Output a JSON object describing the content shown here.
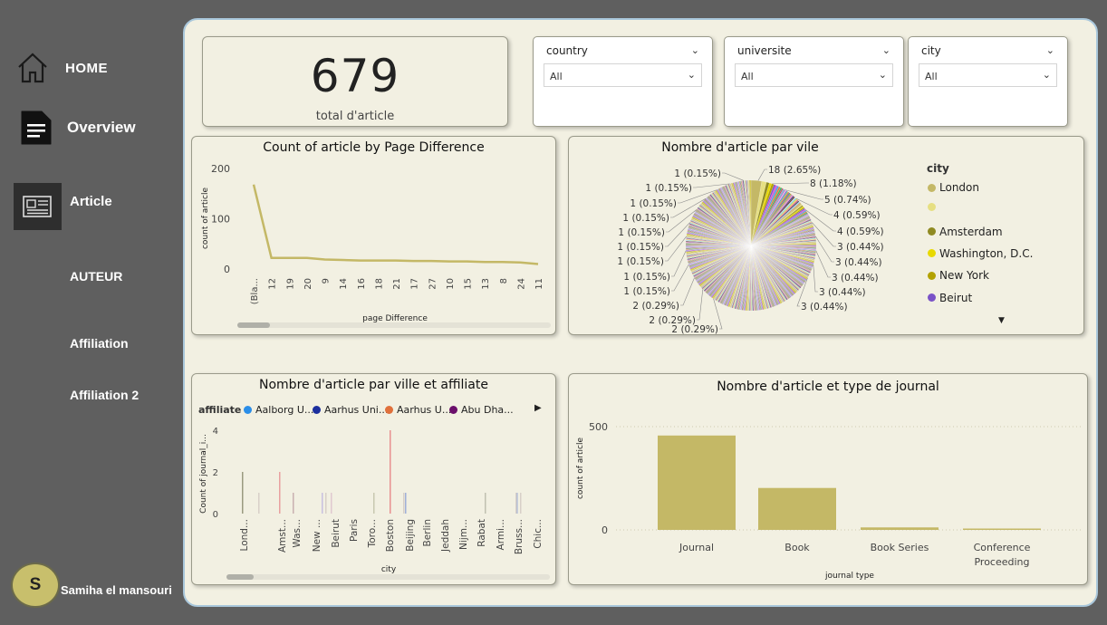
{
  "sidebar": {
    "home_label": "HOME",
    "overview_label": "Overview",
    "article_label": "Article",
    "auteur_label": "AUTEUR",
    "affiliation_label": "Affiliation",
    "affiliation2_label": "Affiliation 2",
    "user_initial": "S",
    "user_name": "Samiha el mansouri"
  },
  "kpi": {
    "value": "679",
    "label": "total d'article"
  },
  "slicers": [
    {
      "title": "country",
      "value": "All"
    },
    {
      "title": "universite",
      "value": "All"
    },
    {
      "title": "city",
      "value": "All"
    }
  ],
  "colors": {
    "accent": "#c4b866",
    "canvas": "#f2f0e2",
    "background": "#5f5f5f"
  },
  "chart_data": [
    {
      "type": "line",
      "title": "Count of article by Page Difference",
      "xlabel": "page Difference",
      "ylabel": "count of article",
      "yticks": [
        0,
        100,
        200
      ],
      "ylim": [
        0,
        200
      ],
      "categories": [
        "(Bla...",
        "12",
        "19",
        "20",
        "9",
        "14",
        "16",
        "18",
        "21",
        "17",
        "27",
        "10",
        "15",
        "13",
        "8",
        "24",
        "11"
      ],
      "values": [
        168,
        22,
        22,
        22,
        19,
        18,
        17,
        17,
        17,
        16,
        16,
        15,
        15,
        14,
        14,
        13,
        10
      ]
    },
    {
      "type": "pie",
      "title": "Nombre d'article par vile",
      "legend_title": "city",
      "legend": [
        {
          "name": "London",
          "color": "#c4b866"
        },
        {
          "name": "",
          "color": "#e6df82"
        },
        {
          "name": "Amsterdam",
          "color": "#8f8a22"
        },
        {
          "name": "Washington, D.C.",
          "color": "#e8d900"
        },
        {
          "name": "New York",
          "color": "#b3a200"
        },
        {
          "name": "Beirut",
          "color": "#7a52c7"
        }
      ],
      "labels_right": [
        "18 (2.65%)",
        "8 (1.18%)",
        "5 (0.74%)",
        "4 (0.59%)",
        "4 (0.59%)",
        "3 (0.44%)",
        "3 (0.44%)",
        "3 (0.44%)",
        "3 (0.44%)",
        "3 (0.44%)"
      ],
      "labels_left": [
        "1 (0.15%)",
        "1 (0.15%)",
        "1 (0.15%)",
        "1 (0.15%)",
        "1 (0.15%)",
        "1 (0.15%)",
        "1 (0.15%)",
        "1 (0.15%)",
        "1 (0.15%)",
        "2 (0.29%)",
        "2 (0.29%)",
        "2 (0.29%)"
      ]
    },
    {
      "type": "bar",
      "title": "Nombre d'article par ville et affiliate",
      "legend_title": "affiliate",
      "legend": [
        {
          "name": "Aalborg U...",
          "color": "#2b8ee8"
        },
        {
          "name": "Aarhus Uni...",
          "color": "#1c2f9e"
        },
        {
          "name": "Aarhus U...",
          "color": "#e0703b"
        },
        {
          "name": "Abu Dha...",
          "color": "#6b0f6b"
        }
      ],
      "xlabel": "city",
      "ylabel": "Count of journal_i...",
      "yticks": [
        0,
        2,
        4
      ],
      "ylim": [
        0,
        4
      ],
      "categories": [
        "Lond...",
        "Amst...",
        "Was...",
        "New ...",
        "Beirut",
        "Paris",
        "Toro...",
        "Boston",
        "Beijing",
        "Berlin",
        "Jeddah",
        "Nijm...",
        "Rabat",
        "Armi...",
        "Bruss...",
        "Chic..."
      ],
      "values": [
        2,
        2,
        1,
        1,
        1,
        0,
        1,
        4,
        1,
        0,
        0,
        0,
        1,
        0,
        1,
        0
      ]
    },
    {
      "type": "bar",
      "title": "Nombre d'article et type de journal",
      "xlabel": "journal type",
      "ylabel": "count of article",
      "yticks": [
        0,
        500
      ],
      "ylim": [
        0,
        500
      ],
      "categories": [
        "Journal",
        "Book",
        "Book Series",
        "Conference Proceeding"
      ],
      "values": [
        457,
        203,
        12,
        5
      ]
    }
  ]
}
